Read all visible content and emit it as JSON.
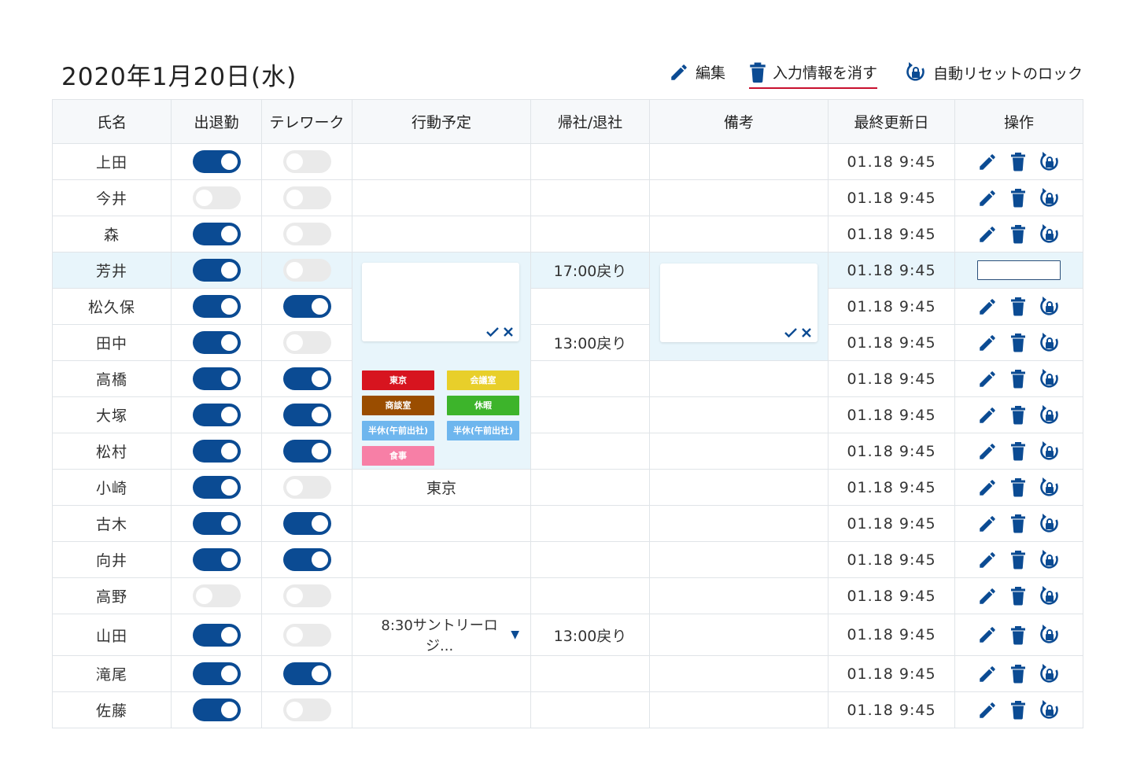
{
  "page": {
    "title": "2020年1月20日(水)"
  },
  "toolbar": {
    "edit_label": "編集",
    "clear_label": "入力情報を消す",
    "lock_label": "自動リセットのロック"
  },
  "colors": {
    "accent": "#0b4b93",
    "highlight_row": "#e8f5fb",
    "underline": "#c8102e"
  },
  "table": {
    "headers": [
      "氏名",
      "出退勤",
      "テレワーク",
      "行動予定",
      "帰社/退社",
      "備考",
      "最終更新日",
      "操作"
    ],
    "rows": [
      {
        "name": "上田",
        "attend": true,
        "tele": false,
        "plan": "",
        "ret": "",
        "note": "",
        "updated": "01.18 9:45"
      },
      {
        "name": "今井",
        "attend": false,
        "tele": false,
        "plan": "",
        "ret": "",
        "note": "",
        "updated": "01.18 9:45"
      },
      {
        "name": "森",
        "attend": true,
        "tele": false,
        "plan": "",
        "ret": "",
        "note": "",
        "updated": "01.18 9:45"
      },
      {
        "name": "芳井",
        "attend": true,
        "tele": false,
        "plan": "",
        "ret": "17:00戻り",
        "note": "",
        "updated": "01.18 9:45"
      },
      {
        "name": "松久保",
        "attend": true,
        "tele": true,
        "plan": "",
        "ret": "",
        "note": "",
        "updated": "01.18 9:45"
      },
      {
        "name": "田中",
        "attend": true,
        "tele": false,
        "plan": "",
        "ret": "13:00戻り",
        "note": "",
        "updated": "01.18 9:45"
      },
      {
        "name": "高橋",
        "attend": true,
        "tele": true,
        "plan": "",
        "ret": "",
        "note": "",
        "updated": "01.18 9:45"
      },
      {
        "name": "大塚",
        "attend": true,
        "tele": true,
        "plan": "",
        "ret": "",
        "note": "",
        "updated": "01.18 9:45"
      },
      {
        "name": "松村",
        "attend": true,
        "tele": true,
        "plan": "",
        "ret": "",
        "note": "",
        "updated": "01.18 9:45"
      },
      {
        "name": "小崎",
        "attend": true,
        "tele": false,
        "plan": "東京",
        "ret": "",
        "note": "",
        "updated": "01.18 9:45"
      },
      {
        "name": "古木",
        "attend": true,
        "tele": true,
        "plan": "",
        "ret": "",
        "note": "",
        "updated": "01.18 9:45"
      },
      {
        "name": "向井",
        "attend": true,
        "tele": true,
        "plan": "",
        "ret": "",
        "note": "",
        "updated": "01.18 9:45"
      },
      {
        "name": "高野",
        "attend": false,
        "tele": false,
        "plan": "",
        "ret": "",
        "note": "",
        "updated": "01.18 9:45"
      },
      {
        "name": "山田",
        "attend": true,
        "tele": false,
        "plan": "8:30サントリーロジ...",
        "ret": "13:00戻り",
        "note": "",
        "updated": "01.18 9:45"
      },
      {
        "name": "滝尾",
        "attend": true,
        "tele": true,
        "plan": "",
        "ret": "",
        "note": "",
        "updated": "01.18 9:45"
      },
      {
        "name": "佐藤",
        "attend": true,
        "tele": false,
        "plan": "",
        "ret": "",
        "note": "",
        "updated": "01.18 9:45"
      }
    ]
  },
  "plan_tags": [
    {
      "label": "東京",
      "color": "#d7141f"
    },
    {
      "label": "会議室",
      "color": "#e8cf2a"
    },
    {
      "label": "商談室",
      "color": "#9a4d00"
    },
    {
      "label": "休暇",
      "color": "#3db42b"
    },
    {
      "label": "半休(午前出社)",
      "color": "#6eb6ee"
    },
    {
      "label": "半休(午前出社)",
      "color": "#6eb6ee"
    },
    {
      "label": "食事",
      "color": "#f77fa6"
    }
  ],
  "icons": {
    "edit": "pencil-icon",
    "delete": "trash-icon",
    "lock": "lock-reset-icon",
    "confirm": "check-icon",
    "cancel": "close-icon",
    "dropdown": "triangle-down-icon"
  }
}
